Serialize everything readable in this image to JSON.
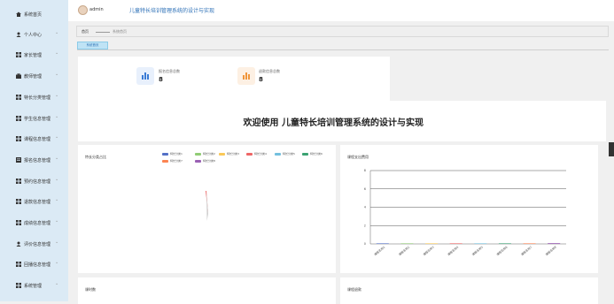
{
  "app": {
    "title": "儿童特长培训管理系统的设计与实现",
    "user": "admin"
  },
  "sidebar": {
    "items": [
      {
        "label": "系统首页",
        "icon": "home-icon",
        "chevron": ""
      },
      {
        "label": "个人中心",
        "icon": "user-icon",
        "chevron": "⌄"
      },
      {
        "label": "家长管理",
        "icon": "grid-icon",
        "chevron": "⌄"
      },
      {
        "label": "教师管理",
        "icon": "briefcase-icon",
        "chevron": "⌄"
      },
      {
        "label": "特长分类管理",
        "icon": "grid-icon",
        "chevron": "⌄"
      },
      {
        "label": "学生信息管理",
        "icon": "grid-icon",
        "chevron": "⌄"
      },
      {
        "label": "课程信息管理",
        "icon": "grid-icon",
        "chevron": "⌄"
      },
      {
        "label": "报名信息管理",
        "icon": "list-icon",
        "chevron": "⌄"
      },
      {
        "label": "预约信息管理",
        "icon": "grid-icon",
        "chevron": "⌄"
      },
      {
        "label": "退款信息管理",
        "icon": "grid-icon",
        "chevron": "⌄"
      },
      {
        "label": "成绩信息管理",
        "icon": "grid-icon",
        "chevron": "⌄"
      },
      {
        "label": "评价信息管理",
        "icon": "user-icon",
        "chevron": "⌄"
      },
      {
        "label": "回播信息管理",
        "icon": "grid-icon",
        "chevron": "⌄"
      },
      {
        "label": "系统管理",
        "icon": "grid-icon",
        "chevron": "⌄"
      }
    ]
  },
  "breadcrumb": {
    "home": "首页",
    "current": "系统首页"
  },
  "tabs": [
    {
      "label": "系统首页"
    }
  ],
  "stats": [
    {
      "label": "报名信息总数",
      "value": "8",
      "color": "#3a7bd5",
      "bg": "#e8f0fc"
    },
    {
      "label": "退款信息总数",
      "value": "8",
      "color": "#f0953a",
      "bg": "#fdf0e3"
    }
  ],
  "welcome": "欢迎使用 儿童特长培训管理系统的设计与实现",
  "panels": {
    "pie_title": "特长分类占比",
    "bar_title": "课程支出费用",
    "bottom_left_title": "课时数",
    "bottom_right_title": "课程退款"
  },
  "chart_data": [
    {
      "type": "pie",
      "title": "特长分类占比",
      "series": [
        {
          "name": "特长分类1",
          "color": "#5470c6"
        },
        {
          "name": "特长分类2",
          "color": "#91cc75"
        },
        {
          "name": "特长分类3",
          "color": "#fac858"
        },
        {
          "name": "特长分类4",
          "color": "#ee6666"
        },
        {
          "name": "特长分类5",
          "color": "#73c0de"
        },
        {
          "name": "特长分类6",
          "color": "#3ba272"
        },
        {
          "name": "特长分类7",
          "color": "#fc8452"
        },
        {
          "name": "特长分类8",
          "color": "#9a60b4"
        }
      ],
      "legend": "top-right"
    },
    {
      "type": "bar",
      "title": "课程支出费用",
      "categories": [
        "课程名称1",
        "课程名称2",
        "课程名称3",
        "课程名称4",
        "课程名称5",
        "课程名称6",
        "课程名称7",
        "课程名称8"
      ],
      "values": [
        0.02,
        0.02,
        0.02,
        0.02,
        0.02,
        0.02,
        0.05,
        0.08
      ],
      "colors": [
        "#5470c6",
        "#91cc75",
        "#fac858",
        "#ee6666",
        "#73c0de",
        "#3ba272",
        "#fc8452",
        "#9a60b4"
      ],
      "ylim": [
        0,
        8
      ],
      "yticks": [
        "0",
        "2",
        "4",
        "6",
        "8"
      ],
      "grid": true
    }
  ]
}
